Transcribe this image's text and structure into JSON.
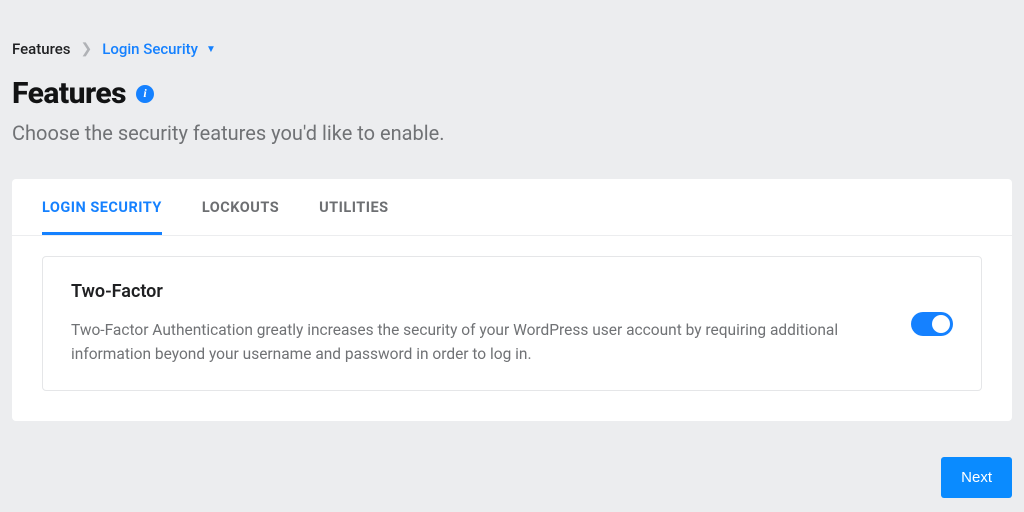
{
  "breadcrumb": {
    "root": "Features",
    "current": "Login Security"
  },
  "page": {
    "title": "Features",
    "subtitle": "Choose the security features you'd like to enable."
  },
  "tabs": [
    {
      "label": "LOGIN SECURITY",
      "active": true
    },
    {
      "label": "LOCKOUTS",
      "active": false
    },
    {
      "label": "UTILITIES",
      "active": false
    }
  ],
  "feature": {
    "title": "Two-Factor",
    "description": "Two-Factor Authentication greatly increases the security of your WordPress user account by requiring additional information beyond your username and password in order to log in.",
    "enabled": true
  },
  "footer": {
    "next_label": "Next"
  },
  "colors": {
    "accent": "#1581ff"
  }
}
